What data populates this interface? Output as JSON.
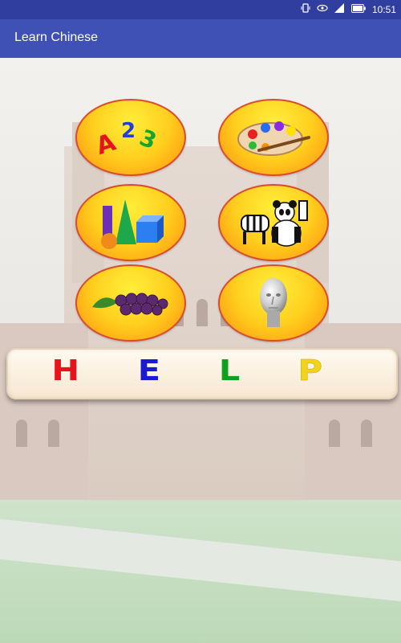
{
  "status_bar": {
    "time": "10:51",
    "icons": [
      "vibrate-icon",
      "eye-comfort-icon",
      "signal-icon",
      "battery-icon"
    ]
  },
  "app_bar": {
    "title": "Learn Chinese"
  },
  "menu_buttons": [
    {
      "name": "numbers-button",
      "icon": "numbers-icon",
      "row": 1,
      "col": 1
    },
    {
      "name": "colors-button",
      "icon": "palette-icon",
      "row": 1,
      "col": 2
    },
    {
      "name": "shapes-button",
      "icon": "shapes-icon",
      "row": 2,
      "col": 1
    },
    {
      "name": "animals-button",
      "icon": "animals-icon",
      "row": 2,
      "col": 2
    },
    {
      "name": "fruits-button",
      "icon": "grapes-icon",
      "row": 3,
      "col": 1
    },
    {
      "name": "body-button",
      "icon": "head-icon",
      "row": 3,
      "col": 2
    }
  ],
  "help": {
    "letters": [
      "H",
      "E",
      "L",
      "P"
    ],
    "colors": [
      "#e8141b",
      "#1a1ad6",
      "#10a01e",
      "#f2d21a"
    ]
  },
  "colors": {
    "status_bar": "#303f9f",
    "app_bar": "#3f51b5",
    "button_border": "#d94c2e"
  }
}
